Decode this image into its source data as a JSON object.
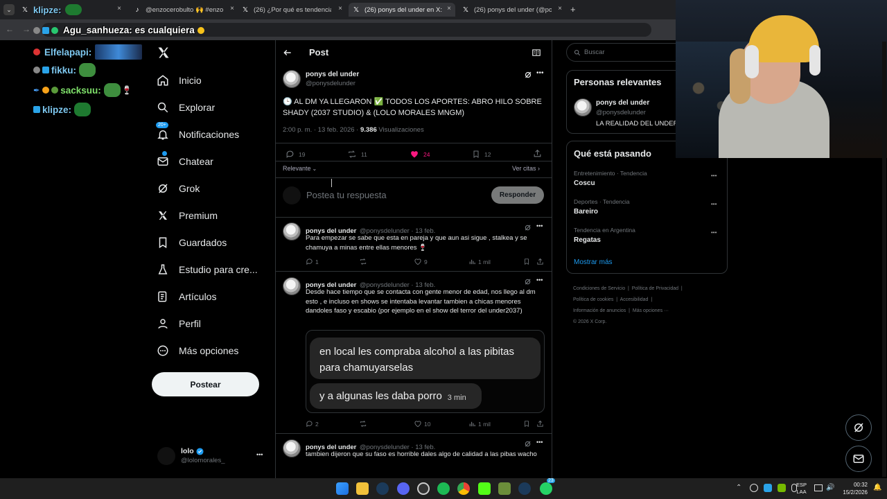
{
  "browser": {
    "tabs": [
      {
        "label": "klipze:",
        "close": "×"
      },
      {
        "label": "@enzocerobulto 🙌 #enzocer",
        "close": "×"
      },
      {
        "label": "(26) ¿Por qué es tendencia? en",
        "close": "×"
      },
      {
        "label": "(26) ponys del under en X: \"",
        "close": "×"
      },
      {
        "label": "(26) ponys del under (@ponysd",
        "close": "×"
      }
    ],
    "new_tab": "+",
    "address_overlay": "Agu_sanhueza: es cualquiera"
  },
  "chat": {
    "lines": [
      {
        "name": "Elfelapapi:",
        "msg": ""
      },
      {
        "name": "fikku:",
        "msg": ""
      },
      {
        "name": "sacksuu:",
        "msg": ""
      },
      {
        "name": "klipze:",
        "msg": ""
      }
    ]
  },
  "nav": {
    "items": [
      {
        "label": "Inicio",
        "icon": "home-icon"
      },
      {
        "label": "Explorar",
        "icon": "search-icon"
      },
      {
        "label": "Notificaciones",
        "icon": "bell-icon",
        "badge": "20+"
      },
      {
        "label": "Chatear",
        "icon": "mail-icon"
      },
      {
        "label": "Grok",
        "icon": "grok-icon"
      },
      {
        "label": "Premium",
        "icon": "x-icon"
      },
      {
        "label": "Guardados",
        "icon": "bookmark-icon"
      },
      {
        "label": "Estudio para cre...",
        "icon": "flask-icon"
      },
      {
        "label": "Artículos",
        "icon": "article-icon"
      },
      {
        "label": "Perfil",
        "icon": "person-icon"
      },
      {
        "label": "Más opciones",
        "icon": "more-icon"
      }
    ],
    "post_button": "Postear",
    "account": {
      "name": "lolo",
      "handle": "@lolomorales_",
      "more": "•••"
    }
  },
  "post": {
    "header_title": "Post",
    "author_name": "ponys del under",
    "author_handle": "@ponysdelunder",
    "text": "🕒 AL DM YA LLEGARON ✅ TODOS LOS APORTES: ABRO HILO SOBRE SHADY (2037 STUDIO) & (LOLO MORALES MNGM)",
    "time": "2:00 p. m. · 13 feb. 2026 · ",
    "views_count": "9.386",
    "views_label": " Visualizaciones",
    "replies": "19",
    "reposts": "11",
    "likes": "24",
    "bookmarks": "12",
    "sort_label": "Relevante",
    "quotes_label": "Ver citas ›",
    "reply_placeholder": "Postea tu respuesta",
    "reply_button": "Responder"
  },
  "replies": [
    {
      "name": "ponys del under",
      "meta": "@ponysdelunder · 13 feb.",
      "text": "Para empezar se sabe que esta en pareja y que aun asi sigue , stalkea y se chamuya a minas entre ellas menores 🍷",
      "replies": "1",
      "reposts": "",
      "likes": "9",
      "views": "1 mil"
    },
    {
      "name": "ponys del under",
      "meta": "@ponysdelunder · 13 feb.",
      "text": "Desde hace tiempo que se contacta con gente menor de edad, nos llego al dm esto , e incluso en shows se intentaba levantar tambien a chicas menores dandoles faso y escabio (por ejemplo en el show del terror del under2037)",
      "image_bubble_1": "en local les compraba alcohol a las pibitas para chamuyarselas",
      "image_bubble_2": "y a algunas les daba porro",
      "image_bubble_2_time": "3 min",
      "replies": "2",
      "reposts": "",
      "likes": "10",
      "views": "1 mil"
    },
    {
      "name": "ponys del under",
      "meta": "@ponysdelunder · 13 feb.",
      "text": "tambien dijeron que su faso es horrible dales algo de calidad a las pibas wacho"
    }
  ],
  "right": {
    "search_placeholder": "Buscar",
    "relevant_title": "Personas relevantes",
    "relevant_person": {
      "name": "ponys del under",
      "handle": "@ponysdelunder",
      "bio": "LA REALIDAD DEL UNDER"
    },
    "trending_title": "Qué está pasando",
    "trends": [
      {
        "category": "Entretenimiento · Tendencia",
        "name": "Coscu"
      },
      {
        "category": "Deportes · Tendencia",
        "name": "Bareiro"
      },
      {
        "category": "Tendencia en Argentina",
        "name": "Regatas"
      }
    ],
    "show_more": "Mostrar más",
    "footer": {
      "l1a": "Condiciones de Servicio",
      "l1b": "Política de Privacidad",
      "l2a": "Política de cookies",
      "l2b": "Accesibilidad",
      "l3a": "Información de anuncios",
      "l3b": "Más opciones ···",
      "l4": "© 2026 X Corp."
    }
  },
  "taskbar": {
    "lang": "ESP",
    "lang2": "LAA",
    "time": "00:32",
    "date": "15/2/2026",
    "whatsapp_badge": "23"
  },
  "colors": {
    "accent": "#1d9bf0",
    "like": "#f91880",
    "bg": "#000000",
    "border": "#2f3336"
  }
}
